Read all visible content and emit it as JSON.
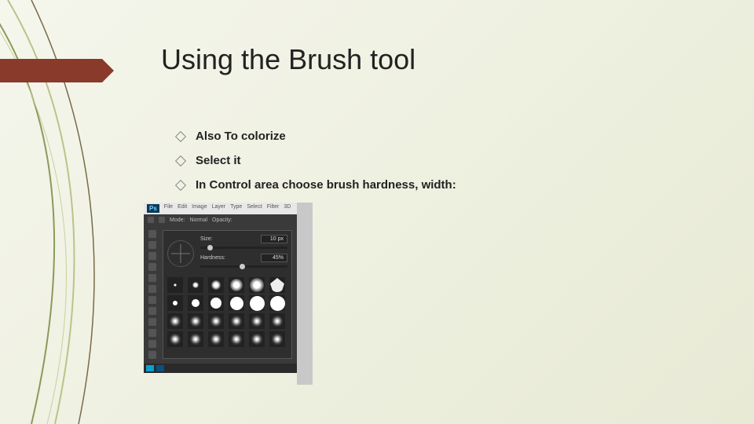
{
  "title": "Using the Brush tool",
  "bullets": [
    "Also To colorize",
    "Select it",
    "In Control area choose brush hardness, width:"
  ],
  "ps": {
    "logo": "Ps",
    "menu": [
      "File",
      "Edit",
      "Image",
      "Layer",
      "Type",
      "Select",
      "Filter",
      "3D"
    ],
    "mode_label": "Mode:",
    "mode_value": "Normal",
    "opacity_label": "Opacity:",
    "size_label": "Size:",
    "size_value": "10 px",
    "hardness_label": "Hardness:",
    "hardness_value": "45%"
  }
}
